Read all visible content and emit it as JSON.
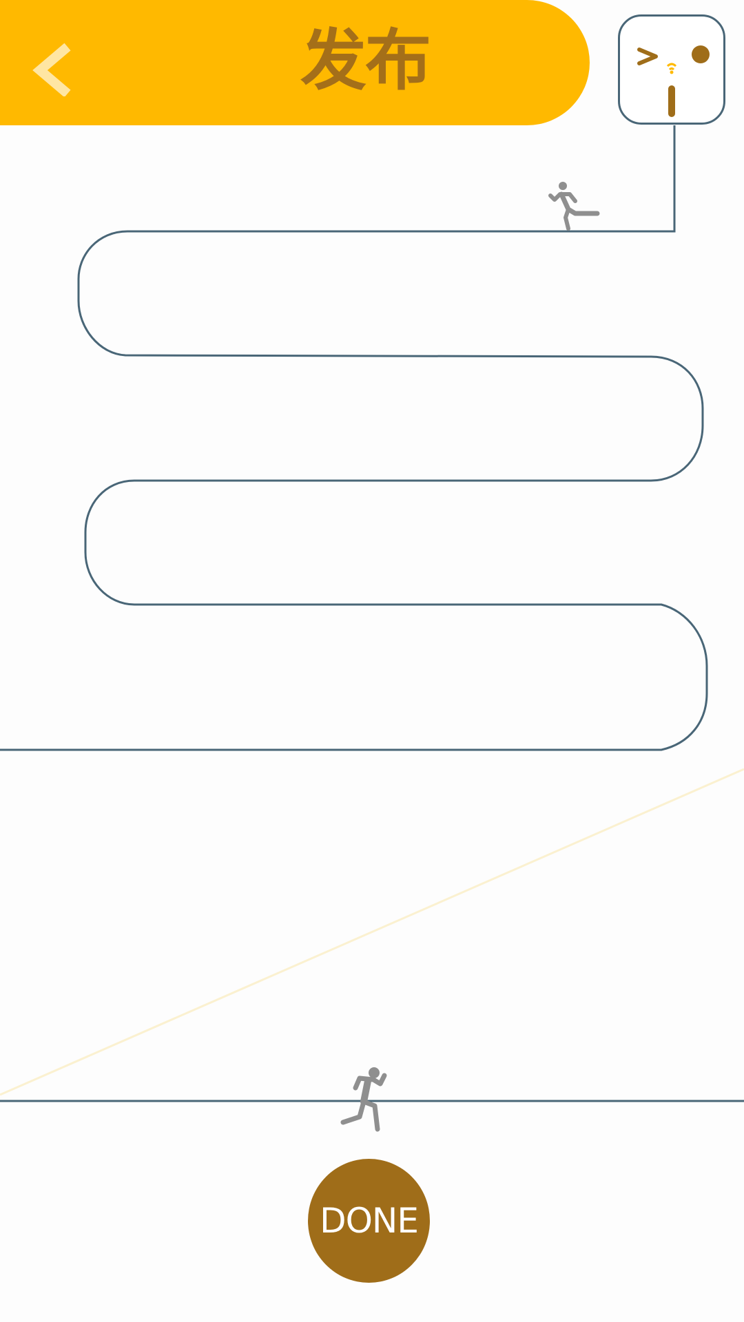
{
  "header": {
    "title": "发布",
    "back_icon": "chevron-left-icon",
    "background_color": "#ffb900",
    "title_color": "#a46f19"
  },
  "logo": {
    "icon": "robot-face-logo-icon",
    "border_color": "#496677"
  },
  "track": {
    "line_color": "#496677",
    "runner_icon": "running-person-icon",
    "runner_color": "#8f8f8f"
  },
  "done_button": {
    "label": "DONE",
    "background_color": "#9f6d19"
  }
}
